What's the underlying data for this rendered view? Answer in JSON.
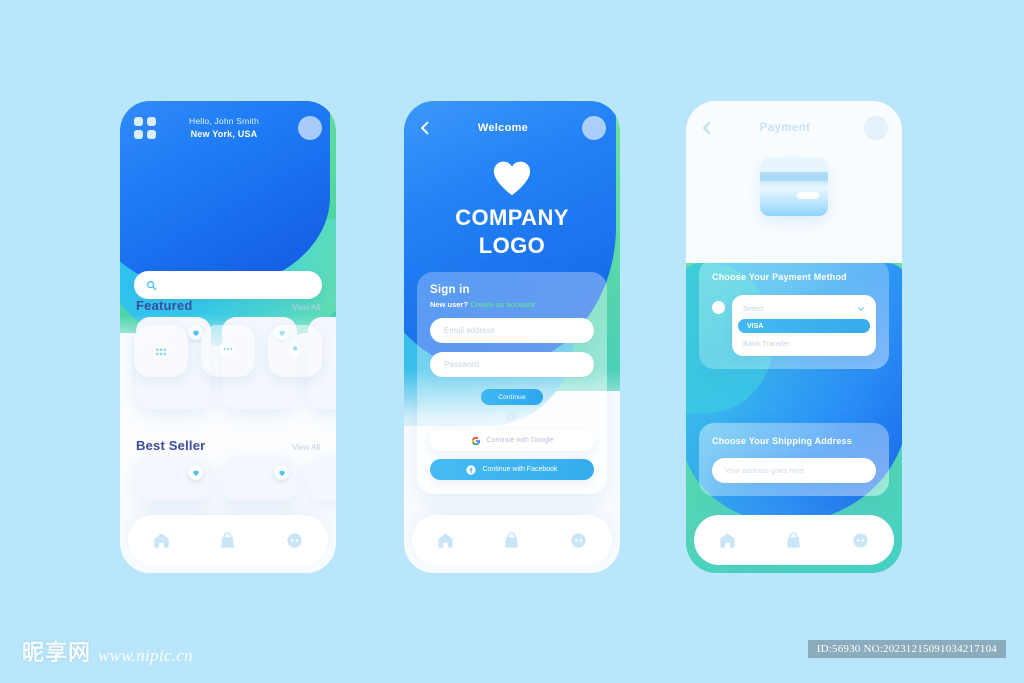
{
  "background_color": "#b9e6fa",
  "accent_colors": {
    "blue": "#1e7bf5",
    "cyan": "#35c8ea",
    "green": "#5fd68f",
    "navy_text": "#3d4d9e",
    "button_blue": "#3fb8f2"
  },
  "home_screen": {
    "name": "Home",
    "greeting_line1": "Hello, John Smith",
    "greeting_line2": "New York, USA",
    "menu_icon": "grid-icon",
    "avatar_icon": "avatar",
    "search": {
      "placeholder": "",
      "icon": "search-icon"
    },
    "quick_actions": [
      {
        "icon": "calendar-icon",
        "label": "Calendar"
      },
      {
        "icon": "chat-bubble-icon",
        "label": "Messages"
      },
      {
        "icon": "location-pin-icon",
        "label": "Location"
      }
    ],
    "sections": [
      {
        "title": "Featured",
        "link": "View All",
        "cards": 3
      },
      {
        "title": "Best Seller",
        "link": "View All",
        "cards": 3
      }
    ],
    "card_favorite_icon": "heart-icon",
    "tabbar": [
      {
        "icon": "home-icon",
        "label": "Home"
      },
      {
        "icon": "bag-icon",
        "label": "Shop"
      },
      {
        "icon": "chat-icon",
        "label": "Chat"
      }
    ]
  },
  "signin_screen": {
    "name": "Welcome",
    "back_icon": "back-chevron-icon",
    "title": "Welcome",
    "avatar_icon": "avatar",
    "logo_icon": "heart-icon",
    "logo_line1": "COMPANY",
    "logo_line2": "LOGO",
    "form": {
      "heading": "Sign in",
      "new_user_prefix": "New user?",
      "create_account_link": "Create an account",
      "email_placeholder": "Email address",
      "password_placeholder": "Password",
      "continue_label": "Continue",
      "or_label": "Or",
      "google_label": "Continue with Google",
      "google_icon": "google-icon",
      "facebook_label": "Continue with Facebook",
      "facebook_icon": "facebook-icon"
    },
    "tabbar": [
      {
        "icon": "home-icon",
        "label": "Home"
      },
      {
        "icon": "bag-icon",
        "label": "Shop"
      },
      {
        "icon": "chat-icon",
        "label": "Chat"
      }
    ]
  },
  "payment_screen": {
    "name": "Payment",
    "back_icon": "back-chevron-icon",
    "title": "Payment",
    "avatar_icon": "avatar",
    "card_icon": "credit-card-icon",
    "payment_method": {
      "title": "Choose Your Payment Method",
      "radio_icon": "radio-button",
      "select_placeholder": "Select",
      "chevron_icon": "chevron-down-icon",
      "options": [
        "VISA",
        "Bank Transfer"
      ],
      "selected_option": "VISA"
    },
    "shipping": {
      "title": "Choose Your Shipping Address",
      "address_placeholder": "Your address goes here"
    },
    "tabbar": [
      {
        "icon": "home-icon",
        "label": "Home"
      },
      {
        "icon": "bag-icon",
        "label": "Shop"
      },
      {
        "icon": "chat-icon",
        "label": "Chat"
      }
    ]
  },
  "watermark": {
    "site_cn": "昵享网",
    "site_url": "www.nipic.cn",
    "id_text": "ID:56930 NO:20231215091034217104"
  }
}
